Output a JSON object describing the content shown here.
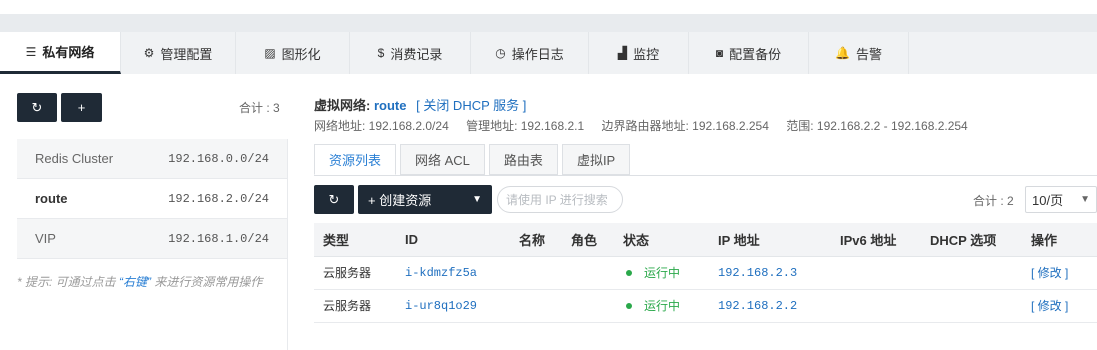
{
  "tabs": [
    {
      "label": "私有网络",
      "icon": "list-icon",
      "glyph": "☰"
    },
    {
      "label": "管理配置",
      "icon": "gears-icon",
      "glyph": "⚙"
    },
    {
      "label": "图形化",
      "icon": "image-icon",
      "glyph": "▨"
    },
    {
      "label": "消费记录",
      "icon": "dollar-icon",
      "glyph": "$"
    },
    {
      "label": "操作日志",
      "icon": "clock-icon",
      "glyph": "◷"
    },
    {
      "label": "监控",
      "icon": "area-chart-icon",
      "glyph": "▟"
    },
    {
      "label": "配置备份",
      "icon": "camera-icon",
      "glyph": "◙"
    },
    {
      "label": "告警",
      "icon": "bell-icon",
      "glyph": "🔔"
    }
  ],
  "left": {
    "refresh_glyph": "↻",
    "add_label": "+",
    "total": "合计 : 3",
    "networks": [
      {
        "name": "Redis Cluster",
        "cidr": "192.168.0.0/24"
      },
      {
        "name": "route",
        "cidr": "192.168.2.0/24"
      },
      {
        "name": "VIP",
        "cidr": "192.168.1.0/24"
      }
    ],
    "hint": {
      "prefix": "* 提示: 可通过点击",
      "keyword": "“右键”",
      "suffix": "来进行资源常用操作"
    }
  },
  "vnet": {
    "label": "虚拟网络:",
    "name": "route",
    "dhcp_link": "[ 关闭 DHCP 服务 ]",
    "info": [
      "网络地址: 192.168.2.0/24",
      "管理地址: 192.168.2.1",
      "边界路由器地址: 192.168.2.254",
      "范围: 192.168.2.2 - 192.168.2.254"
    ]
  },
  "subtabs": [
    "资源列表",
    "网络 ACL",
    "路由表",
    "虚拟IP"
  ],
  "toolbar": {
    "refresh_glyph": "↻",
    "create_label": "+ 创建资源",
    "search_placeholder": "请使用 IP 进行搜索",
    "total": "合计 : 2",
    "page_size": "10/页"
  },
  "table": {
    "headers": [
      "类型",
      "ID",
      "名称",
      "角色",
      "状态",
      "IP 地址",
      "IPv6 地址",
      "DHCP 选项",
      "操作"
    ],
    "rows": [
      {
        "type": "云服务器",
        "id": "i-kdmzfz5a",
        "name": "",
        "role": "",
        "status": "运行中",
        "ip": "192.168.2.3",
        "ipv6": "",
        "dhcp": "",
        "op": "[ 修改 ]"
      },
      {
        "type": "云服务器",
        "id": "i-ur8q1o29",
        "name": "",
        "role": "",
        "status": "运行中",
        "ip": "192.168.2.2",
        "ipv6": "",
        "dhcp": "",
        "op": "[ 修改 ]"
      }
    ]
  }
}
